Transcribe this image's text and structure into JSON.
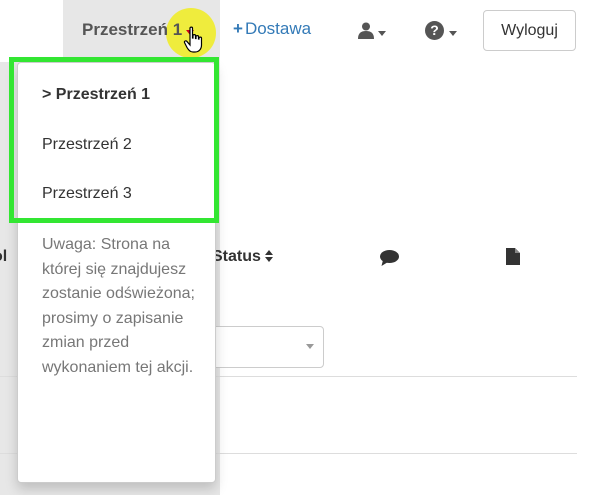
{
  "navbar": {
    "space_toggle_label": "Przestrzeń 1",
    "delivery_label": "Dostawa",
    "delivery_icon": "+",
    "help_icon": "?",
    "logout_label": "Wyloguj"
  },
  "space_menu": {
    "items": [
      {
        "label": "> Przestrzeń 1"
      },
      {
        "label": "Przestrzeń 2"
      },
      {
        "label": "Przestrzeń 3"
      }
    ],
    "note": "Uwaga: Strona na której się znajdujesz zostanie odświeżona; prosimy o zapisanie zmian przed wykonaniem tej akcji."
  },
  "table": {
    "partial_header": "ol",
    "status_header": "Status"
  },
  "colors": {
    "accent_link": "#337ab7",
    "highlight_green": "#33e632",
    "cursor_highlight": "#f0ec1e",
    "toggle_bg": "#e7e7e7"
  }
}
